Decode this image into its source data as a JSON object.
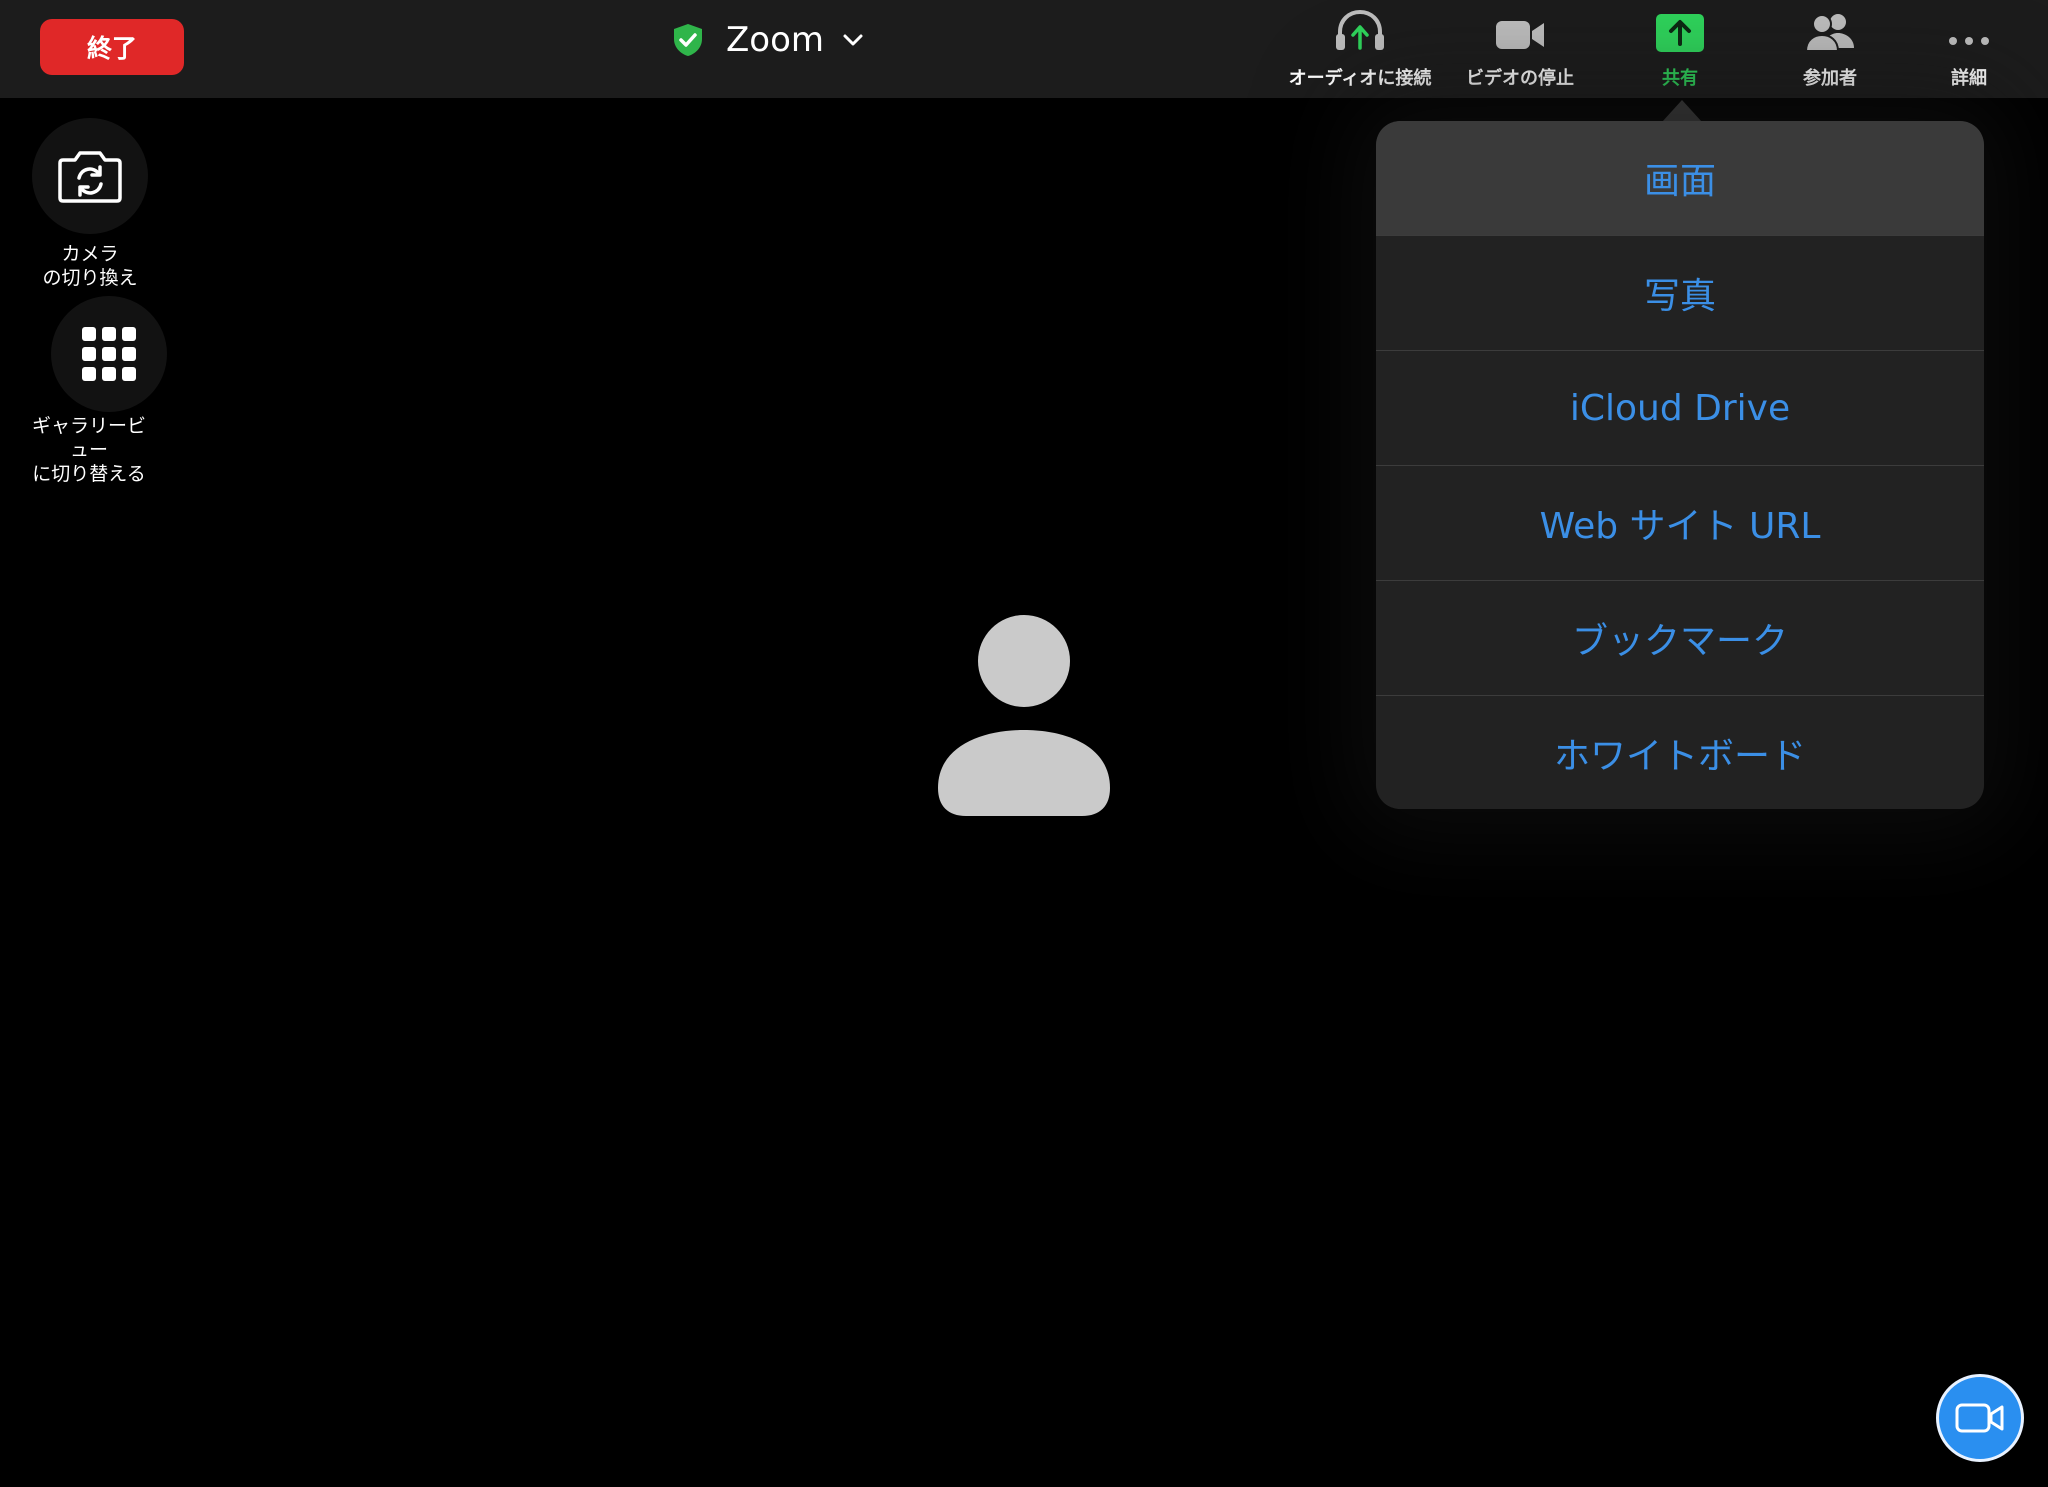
{
  "topbar": {
    "end_label": "終了",
    "title": "Zoom",
    "items": [
      {
        "label": "オーディオに接続",
        "icon": "headphones-icon"
      },
      {
        "label": "ビデオの停止",
        "icon": "video-camera-icon"
      },
      {
        "label": "共有",
        "icon": "share-icon"
      },
      {
        "label": "参加者",
        "icon": "participants-icon"
      },
      {
        "label": "詳細",
        "icon": "more-icon"
      }
    ]
  },
  "side": {
    "camera_label_line1": "カメラ",
    "camera_label_line2": "の切り換え",
    "gallery_label_line1": "ギャラリービ",
    "gallery_label_line2": "ュー",
    "gallery_label_line3": "に切り替える"
  },
  "share_menu": {
    "items": [
      "画面",
      "写真",
      "iCloud Drive",
      "Web サイト URL",
      "ブックマーク",
      "ホワイトボード"
    ]
  },
  "colors": {
    "end_button": "#e02828",
    "share_accent": "#2fd35b",
    "menu_text": "#3b8fe6",
    "video_fab": "#2a8ff0"
  }
}
